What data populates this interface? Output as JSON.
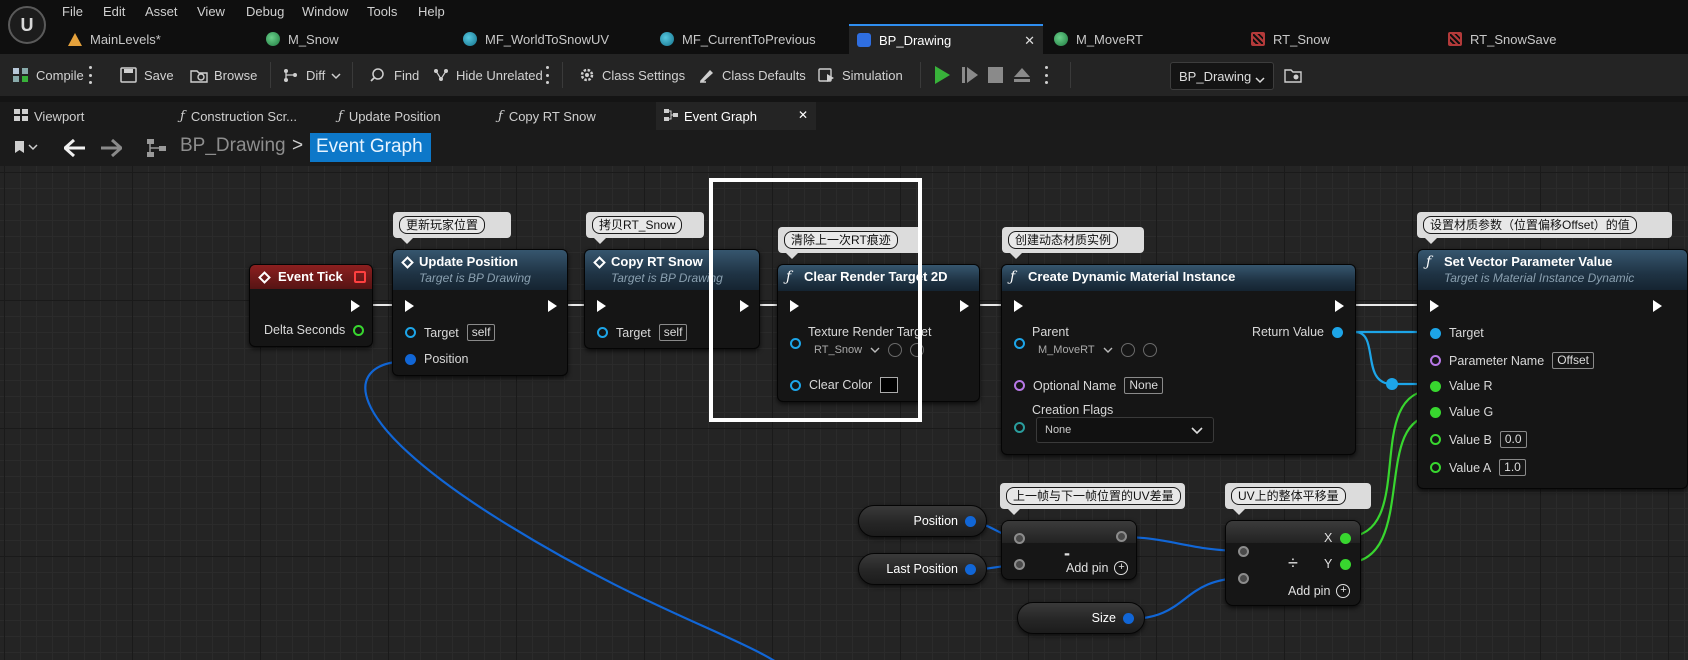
{
  "menu": [
    "File",
    "Edit",
    "Asset",
    "View",
    "Debug",
    "Window",
    "Tools",
    "Help"
  ],
  "logo_text": "U",
  "doc_tabs": [
    {
      "label": "MainLevels*",
      "icon": "level-icon"
    },
    {
      "label": "M_Snow",
      "icon": "material-icon"
    },
    {
      "label": "MF_WorldToSnowUV",
      "icon": "material-function-icon"
    },
    {
      "label": "MF_CurrentToPrevious",
      "icon": "material-function-icon"
    },
    {
      "label": "BP_Drawing",
      "icon": "blueprint-icon",
      "close": "✕"
    },
    {
      "label": "M_MoveRT",
      "icon": "material-icon"
    },
    {
      "label": "RT_Snow",
      "icon": "render-target-icon"
    },
    {
      "label": "RT_SnowSave",
      "icon": "render-target-icon"
    }
  ],
  "toolbar": {
    "compile": "Compile",
    "save": "Save",
    "browse": "Browse",
    "diff": "Diff",
    "find": "Find",
    "hide_unrelated": "Hide Unrelated",
    "class_settings": "Class Settings",
    "class_defaults": "Class Defaults",
    "simulation": "Simulation",
    "debug_object": "BP_Drawing"
  },
  "sub_tabs": [
    {
      "label": "Viewport"
    },
    {
      "label": "Construction Scr..."
    },
    {
      "label": "Update Position"
    },
    {
      "label": "Copy RT Snow"
    },
    {
      "label": "Event Graph",
      "close": "✕"
    }
  ],
  "breadcrumb": {
    "root": "BP_Drawing",
    "sep": ">",
    "current": "Event Graph"
  },
  "comments": {
    "update_pos": "更新玩家位置",
    "copy_rt": "拷贝RT_Snow",
    "clear_rt": "清除上一次RT痕迹",
    "create_dmi": "创建动态材质实例",
    "set_vec": "设置材质参数（位置偏移Offset）的值",
    "uv_delta": "上一帧与下一帧位置的UV差量",
    "uv_offset": "UV上的整体平移量"
  },
  "nodes": {
    "event_tick": {
      "title": "Event Tick",
      "pin_delta": "Delta Seconds"
    },
    "update_position": {
      "title": "Update Position",
      "subtitle": "Target is BP Drawing",
      "pin_target": "Target",
      "target_val": "self",
      "pin_position": "Position"
    },
    "copy_rt_snow": {
      "title": "Copy RT Snow",
      "subtitle": "Target is BP Drawing",
      "pin_target": "Target",
      "target_val": "self"
    },
    "clear_rt": {
      "title": "Clear Render Target 2D",
      "pin_texture": "Texture Render Target",
      "texture_val": "RT_Snow",
      "pin_color": "Clear Color"
    },
    "create_dmi": {
      "title": "Create Dynamic Material Instance",
      "pin_parent": "Parent",
      "parent_val": "M_MoveRT",
      "pin_optname": "Optional Name",
      "optname_val": "None",
      "pin_flags": "Creation Flags",
      "flags_val": "None",
      "pin_return": "Return Value"
    },
    "set_vector": {
      "title": "Set Vector Parameter Value",
      "subtitle": "Target is Material Instance Dynamic",
      "pin_target": "Target",
      "pin_param": "Parameter Name",
      "param_val": "Offset",
      "pin_r": "Value R",
      "pin_g": "Value G",
      "pin_b": "Value B",
      "b_val": "0.0",
      "pin_a": "Value A",
      "a_val": "1.0"
    },
    "var_position": {
      "label": "Position"
    },
    "var_last_position": {
      "label": "Last Position"
    },
    "var_size": {
      "label": "Size"
    },
    "subtract": {
      "op": "-",
      "add_pin": "Add pin"
    },
    "divide": {
      "op": "÷",
      "add_pin": "Add pin",
      "pin_x": "X",
      "pin_y": "Y"
    }
  },
  "colors": {
    "accent": "#0d78c9",
    "exec": "#ffffff",
    "object_pin": "#1da5e8",
    "float_pin": "#38d62f",
    "vector_pin": "#1166d6",
    "name_pin": "#b778e6",
    "play": "#38b23a"
  }
}
